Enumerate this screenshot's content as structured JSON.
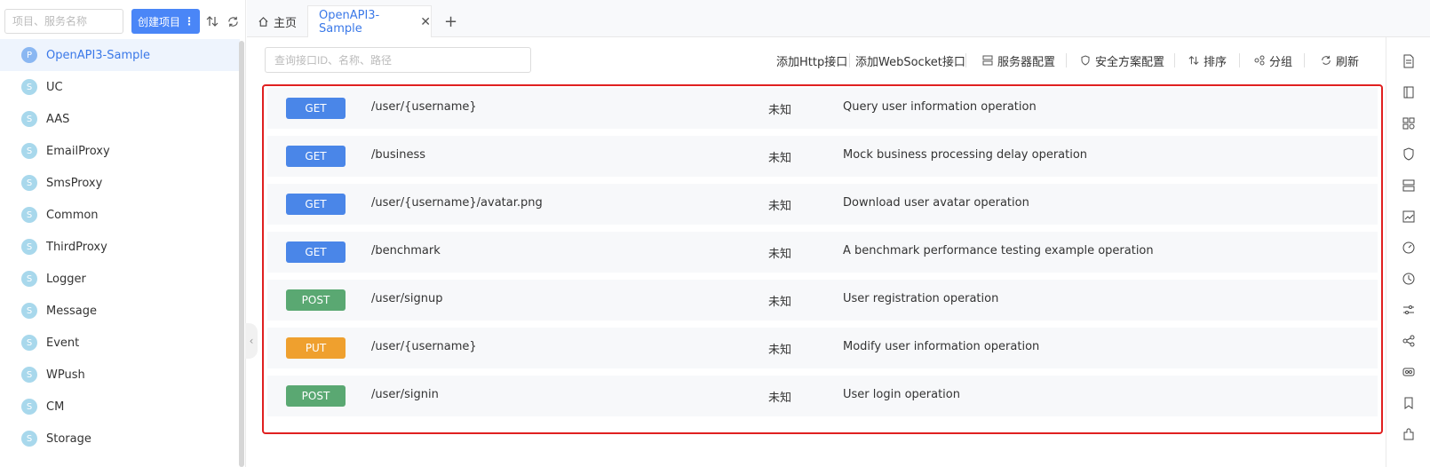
{
  "sidebar": {
    "search_placeholder": "项目、服务名称",
    "create_button": "创建项目",
    "projects": [
      {
        "badge": "P",
        "name": "OpenAPI3-Sample"
      },
      {
        "badge": "S",
        "name": "UC"
      },
      {
        "badge": "S",
        "name": "AAS"
      },
      {
        "badge": "S",
        "name": "EmailProxy"
      },
      {
        "badge": "S",
        "name": "SmsProxy"
      },
      {
        "badge": "S",
        "name": "Common"
      },
      {
        "badge": "S",
        "name": "ThirdProxy"
      },
      {
        "badge": "S",
        "name": "Logger"
      },
      {
        "badge": "S",
        "name": "Message"
      },
      {
        "badge": "S",
        "name": "Event"
      },
      {
        "badge": "S",
        "name": "WPush"
      },
      {
        "badge": "S",
        "name": "CM"
      },
      {
        "badge": "S",
        "name": "Storage"
      }
    ]
  },
  "tabs": {
    "home": "主页",
    "active": "OpenAPI3-Sample"
  },
  "toolbar": {
    "search_placeholder": "查询接口ID、名称、路径",
    "add_http": "添加Http接口",
    "add_websocket": "添加WebSocket接口",
    "server_config": "服务器配置",
    "security_config": "安全方案配置",
    "sort": "排序",
    "group": "分组",
    "refresh": "刷新"
  },
  "apis": [
    {
      "method": "GET",
      "path": "/user/{username}",
      "status": "未知",
      "description": "Query user information operation"
    },
    {
      "method": "GET",
      "path": "/business",
      "status": "未知",
      "description": "Mock business processing delay operation"
    },
    {
      "method": "GET",
      "path": "/user/{username}/avatar.png",
      "status": "未知",
      "description": "Download user avatar operation"
    },
    {
      "method": "GET",
      "path": "/benchmark",
      "status": "未知",
      "description": "A benchmark performance testing example operation"
    },
    {
      "method": "POST",
      "path": "/user/signup",
      "status": "未知",
      "description": "User registration operation"
    },
    {
      "method": "PUT",
      "path": "/user/{username}",
      "status": "未知",
      "description": "Modify user information operation"
    },
    {
      "method": "POST",
      "path": "/user/signin",
      "status": "未知",
      "description": "User login operation"
    }
  ],
  "colors": {
    "accent": "#4a86f7",
    "get": "#4a86e8",
    "post": "#5aa872",
    "put": "#efa02e",
    "highlight_border": "#e02020"
  },
  "right_rail_icons": [
    "document-icon",
    "book-icon",
    "apps-icon",
    "shield-icon",
    "server-icon",
    "chart-icon",
    "gauge-icon",
    "clock-icon",
    "sliders-icon",
    "share-icon",
    "mock-icon",
    "bookmark-icon",
    "plugin-icon"
  ]
}
